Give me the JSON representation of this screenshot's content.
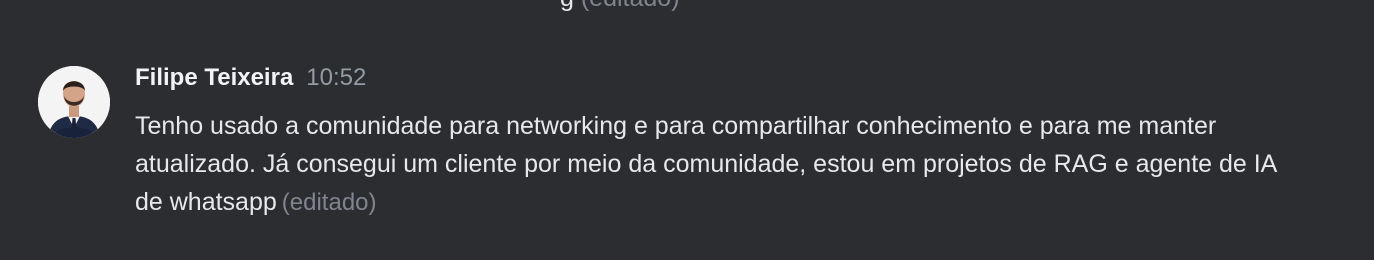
{
  "previous_message": {
    "tail_text": "g",
    "edited_label": "(editado)"
  },
  "message": {
    "author": "Filipe Teixeira",
    "timestamp": "10:52",
    "text": "Tenho usado a comunidade para networking e para compartilhar conhecimento e para me manter atualizado. Já consegui um cliente por meio da comunidade, estou em proje­tos de RAG e agente de IA de whatsapp",
    "edited_label": "(editado)",
    "avatar_icon": "user-avatar-photo"
  },
  "colors": {
    "background": "#2b2d31",
    "author": "#f2f3f5",
    "timestamp": "#949ba4",
    "text": "#e6e8ea",
    "edited": "#80848e"
  }
}
